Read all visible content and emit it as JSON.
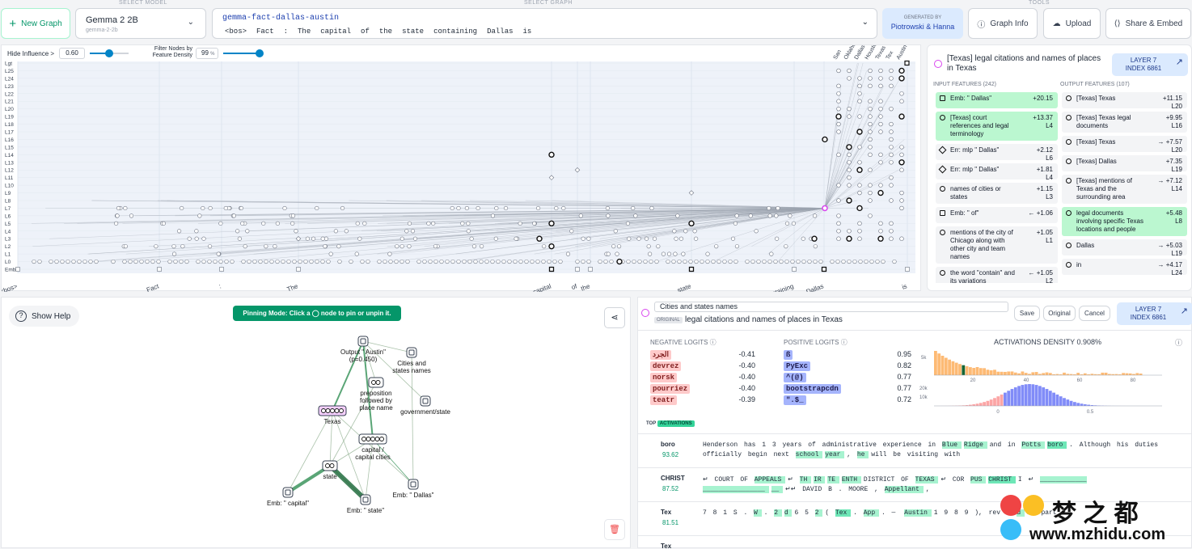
{
  "header": {
    "select_model_label": "SELECT MODEL",
    "select_graph_label": "SELECT GRAPH",
    "tools_label": "TOOLS",
    "new_graph": "New Graph",
    "model_name": "Gemma 2 2B",
    "model_id": "gemma-2-2b",
    "graph_name": "gemma-fact-dallas-austin",
    "prompt_tokens": [
      "<bos>",
      "Fact",
      ":",
      "The",
      "capital",
      "of",
      "the",
      "state",
      "containing",
      "Dallas",
      "is"
    ],
    "generated_by": "GENERATED BY",
    "author": "Piotrowski & Hanna",
    "graph_info": "Graph Info",
    "upload": "Upload",
    "share": "Share & Embed"
  },
  "controls": {
    "hide_influence": "Hide Influence >",
    "hide_value": "0.60",
    "filter_label": "Filter Nodes by Feature Density",
    "filter_value": "99",
    "filter_unit": "%"
  },
  "graph": {
    "layers": [
      "Lgt",
      "L25",
      "L24",
      "L23",
      "L22",
      "L21",
      "L20",
      "L19",
      "L18",
      "L17",
      "L16",
      "L15",
      "L14",
      "L13",
      "L12",
      "L11",
      "L10",
      "L9",
      "L8",
      "L7",
      "L6",
      "L5",
      "L4",
      "L3",
      "L2",
      "L1",
      "L0",
      "Emb"
    ],
    "x_tokens": [
      "<bos>",
      "Fact",
      ":",
      "The",
      "capital",
      "of",
      "the",
      "state",
      "containing",
      "Dallas",
      "is"
    ],
    "output_tokens": [
      "San",
      "Oklahoma",
      "Dallas",
      "Houston",
      "Texas",
      "Tex",
      "Austin"
    ]
  },
  "feature_panel": {
    "title": "[Texas] legal citations and names of places in Texas",
    "layer": "LAYER 7",
    "index": "INDEX 6861",
    "input_header": "INPUT FEATURES (242)",
    "output_header": "OUTPUT FEATURES (107)",
    "inputs": [
      {
        "label": "Emb: \" Dallas\"",
        "value": "+20.15",
        "layer": "",
        "sel": true
      },
      {
        "label": "[Texas] court references and legal terminology",
        "value": "+13.37",
        "layer": "L4",
        "sel": true
      },
      {
        "label": "Err: mlp \" Dallas\"",
        "value": "+2.12",
        "layer": "L6",
        "sel": false
      },
      {
        "label": "Err: mlp \" Dallas\"",
        "value": "+1.81",
        "layer": "L4",
        "sel": false
      },
      {
        "label": "names of cities or states",
        "value": "+1.15",
        "layer": "L3",
        "sel": false
      },
      {
        "label": "Emb: \" of\"",
        "value": "← +1.06",
        "layer": "",
        "sel": false
      },
      {
        "label": "mentions of the city of Chicago along with other city and team names",
        "value": "+1.05",
        "layer": "L1",
        "sel": false
      },
      {
        "label": "the word \"contain\" and its variations",
        "value": "← +1.05",
        "layer": "L2",
        "sel": false
      },
      {
        "label": "Emb: \" Fact\"",
        "value": "← +0.64",
        "layer": "",
        "sel": false
      }
    ],
    "outputs": [
      {
        "label": "[Texas] Texas",
        "value": "+11.15",
        "layer": "L20",
        "sel": false
      },
      {
        "label": "[Texas] Texas legal documents",
        "value": "+9.95",
        "layer": "L16",
        "sel": false
      },
      {
        "label": "[Texas] Texas",
        "value": "→ +7.57",
        "layer": "L20",
        "sel": false
      },
      {
        "label": "[Texas] Dallas",
        "value": "+7.35",
        "layer": "L19",
        "sel": false
      },
      {
        "label": "[Texas] mentions of Texas and the surrounding area",
        "value": "→ +7.12",
        "layer": "L14",
        "sel": false
      },
      {
        "label": "legal documents involving specific Texas locations and people",
        "value": "+5.48",
        "layer": "L8",
        "sel": true
      },
      {
        "label": "Dallas",
        "value": "→ +5.03",
        "layer": "L19",
        "sel": false
      },
      {
        "label": "in",
        "value": "→ +4.17",
        "layer": "L24",
        "sel": false
      }
    ]
  },
  "subgraph": {
    "help": "Show Help",
    "pinning": "Pinning Mode: Click a ◯ node to pin or unpin it.",
    "nodes": [
      "Output \" Austin\" (p=0.450)",
      "Cities and states names",
      "preposition followed by place name",
      "government/state",
      "Texas",
      "capital / capital cities",
      "state",
      "Emb: \" Dallas\"",
      "Emb: \" capital\"",
      "Emb: \" state\""
    ]
  },
  "detail": {
    "name_value": "Cities and states names",
    "original_badge": "ORIGINAL",
    "original_text": "legal citations and names of places in Texas",
    "save": "Save",
    "original_btn": "Original",
    "cancel": "Cancel",
    "layer": "LAYER 7",
    "index": "INDEX 6861",
    "neg_header": "NEGATIVE LOGITS",
    "pos_header": "POSITIVE LOGITS",
    "density": "ACTIVATIONS DENSITY 0.908%",
    "neg": [
      [
        "الجرد",
        "-0.41"
      ],
      [
        "devrez",
        "-0.40"
      ],
      [
        "norsk",
        "-0.40"
      ],
      [
        "pourriez",
        "-0.40"
      ],
      [
        "teatr",
        "-0.39"
      ]
    ],
    "pos": [
      [
        "ß",
        "0.95"
      ],
      [
        "PyExc",
        "0.82"
      ],
      [
        "^(@)",
        "0.77"
      ],
      [
        "bootstrapcdn",
        "0.77"
      ],
      [
        "\".$_",
        "0.72"
      ]
    ],
    "hist_ticks_top": [
      "20",
      "40",
      "60",
      "80"
    ],
    "hist_y_top": "5k",
    "hist_ticks_bottom": [
      "0",
      "0.5"
    ],
    "hist_y_bottom": [
      "20k",
      "10k"
    ],
    "top_label": "TOP",
    "activations_label": "ACTIVATIONS",
    "acts": [
      {
        "token": "boro",
        "value": "93.62",
        "line1": "Henderson has 1 3 years of administrative experience in Blue Ridge and in Potts boro . Although his duties",
        "line2": "officially begin next school year , he will be visiting with"
      },
      {
        "token": "CHRIST",
        "value": "87.52",
        "line1": "↵ COURT OF APPEALS ↵ TH IR TE ENTH DISTRICT OF TEXAS ↵ COR PUS CHRIST I ↵ ____________",
        "line2": "________________ __ ↵↵ DAVID B . MOORE , Appellant ,"
      },
      {
        "token": "Tex",
        "value": "81.51",
        "line1": "7 8 1 S . W . 2 d 6 5 2 ( Tex . App . —  Austin 1 9 8 9 ), rev ' d in part",
        "line2": ""
      },
      {
        "token": "Tex",
        "value": "",
        "line1": "",
        "line2": ""
      }
    ]
  },
  "watermark": {
    "text": "梦 之 都",
    "url": "www.mzhidu.com"
  }
}
